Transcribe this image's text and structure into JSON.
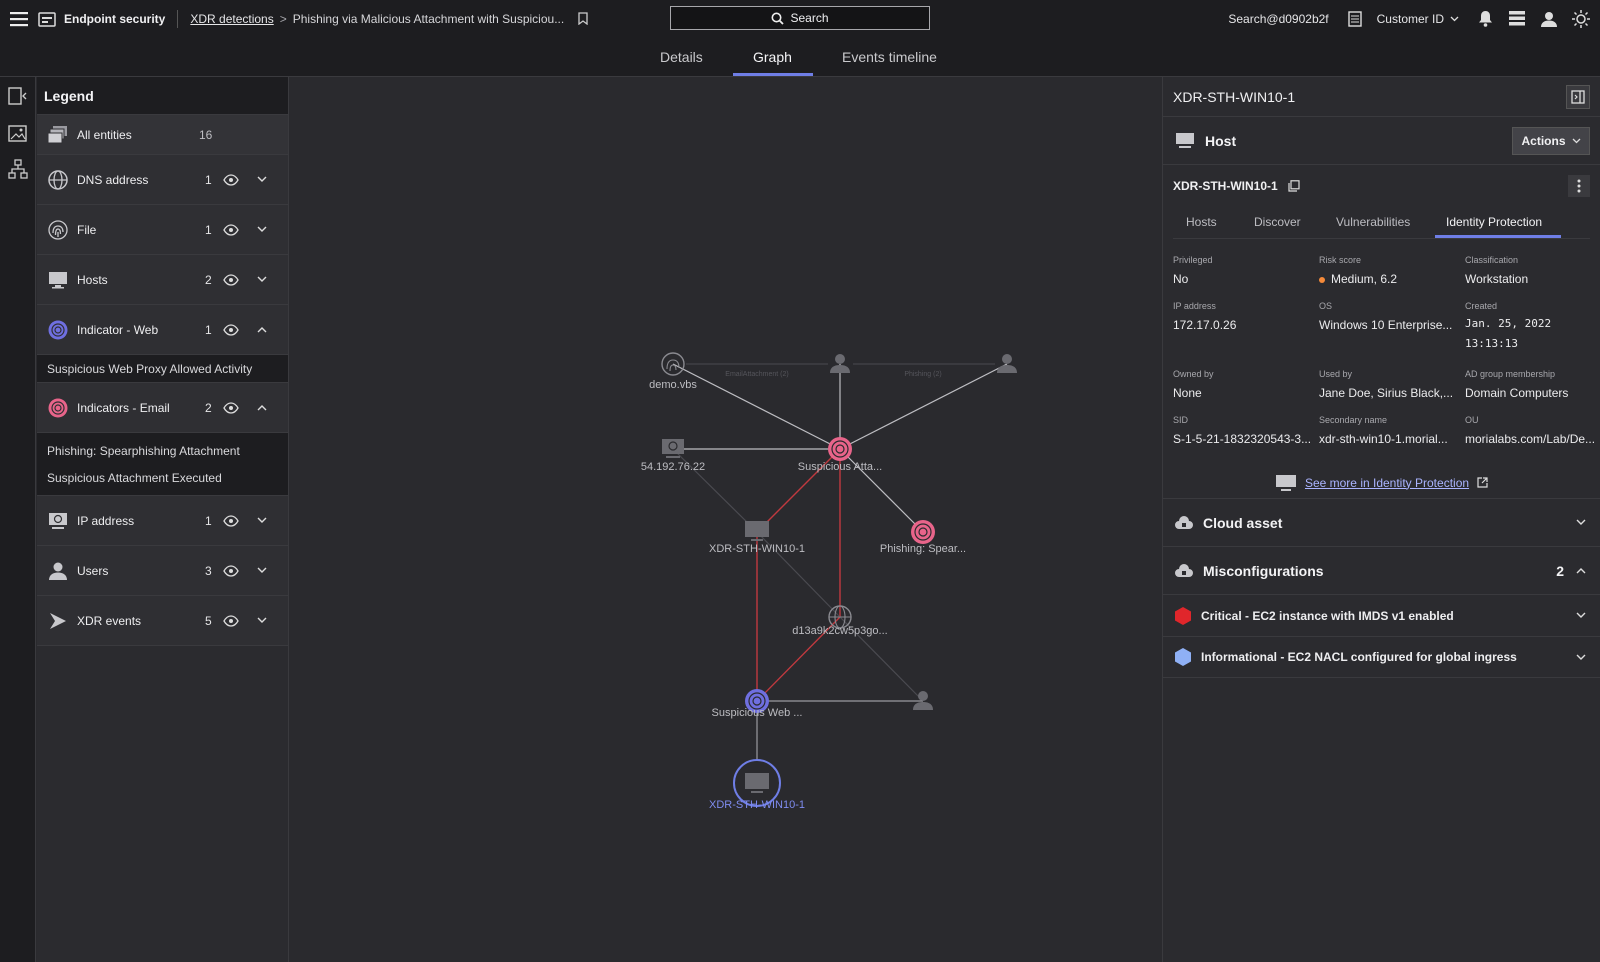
{
  "topbar": {
    "app_title": "Endpoint security",
    "breadcrumb_link": "XDR detections",
    "breadcrumb_sep": ">",
    "breadcrumb_current": "Phishing via Malicious Attachment with Suspiciou...",
    "search_label": "Search",
    "user": "Search@d0902b2f",
    "customer": "Customer ID"
  },
  "tabs": {
    "details": "Details",
    "graph": "Graph",
    "timeline": "Events timeline",
    "active": "Graph"
  },
  "legend": {
    "title": "Legend",
    "all": {
      "label": "All entities",
      "count": "16"
    },
    "items": [
      {
        "label": "DNS address",
        "count": "1",
        "icon": "globe-icon",
        "expanded": false
      },
      {
        "label": "File",
        "count": "1",
        "icon": "fingerprint-icon",
        "expanded": false
      },
      {
        "label": "Hosts",
        "count": "2",
        "icon": "monitor-icon",
        "expanded": false
      },
      {
        "label": "Indicator - Web",
        "count": "1",
        "icon": "indicator-web-icon",
        "expanded": true,
        "children": [
          "Suspicious Web Proxy Allowed Activity"
        ]
      },
      {
        "label": "Indicators - Email",
        "count": "2",
        "icon": "indicator-email-icon",
        "expanded": true,
        "children": [
          "Phishing: Spearphishing Attachment",
          "Suspicious Attachment Executed"
        ]
      },
      {
        "label": "IP address",
        "count": "1",
        "icon": "ip-icon",
        "expanded": false
      },
      {
        "label": "Users",
        "count": "3",
        "icon": "user-icon",
        "expanded": false
      },
      {
        "label": "XDR events",
        "count": "5",
        "icon": "xdr-icon",
        "expanded": false
      }
    ]
  },
  "graph": {
    "nodes": {
      "demo": "demo.vbs",
      "ip": "54.192.76.22",
      "susp_att": "Suspicious Atta...",
      "host1": "XDR-STH-WIN10-1",
      "phishing": "Phishing: Spear...",
      "dns": "d13a9k2cw5p3go...",
      "susp_web": "Suspicious Web ...",
      "host_sel": "XDR-STH-WIN10-1"
    },
    "edges": {
      "email_att": "EmailAttachment (2)",
      "phishing": "Phishing (2)"
    }
  },
  "panel": {
    "title": "XDR-STH-WIN10-1",
    "host_label": "Host",
    "actions": "Actions",
    "hostname": "XDR-STH-WIN10-1",
    "subtabs": [
      "Hosts",
      "Discover",
      "Vulnerabilities",
      "Identity Protection"
    ],
    "active_subtab": "Identity Protection",
    "fields": {
      "privileged": {
        "k": "Privileged",
        "v": "No"
      },
      "risk": {
        "k": "Risk score",
        "v": "Medium, 6.2"
      },
      "classification": {
        "k": "Classification",
        "v": "Workstation"
      },
      "ip": {
        "k": "IP address",
        "v": "172.17.0.26"
      },
      "os": {
        "k": "OS",
        "v": "Windows 10 Enterprise..."
      },
      "created": {
        "k": "Created",
        "v": "Jan. 25, 2022 13:13:13"
      },
      "owned": {
        "k": "Owned by",
        "v": "None"
      },
      "used": {
        "k": "Used by",
        "v": "Jane Doe, Sirius Black,..."
      },
      "adgroup": {
        "k": "AD group membership",
        "v": "Domain Computers"
      },
      "sid": {
        "k": "SID",
        "v": "S-1-5-21-1832320543-3..."
      },
      "secondary": {
        "k": "Secondary name",
        "v": "xdr-sth-win10-1.morial..."
      },
      "ou": {
        "k": "OU",
        "v": "morialabs.com/Lab/De..."
      }
    },
    "see_more": "See more in Identity Protection",
    "cloud_asset": "Cloud asset",
    "misconfig": {
      "label": "Misconfigurations",
      "count": "2"
    },
    "misconfig_items": [
      {
        "label": "Critical - EC2 instance with IMDS v1 enabled",
        "color": "#e0262b"
      },
      {
        "label": "Informational - EC2 NACL configured for global ingress",
        "color": "#8fb0f5"
      }
    ]
  },
  "colors": {
    "accent": "#6f7ee6",
    "pink": "#e8648a",
    "risk_medium": "#f58a3a",
    "red_edge": "#c0393f"
  }
}
